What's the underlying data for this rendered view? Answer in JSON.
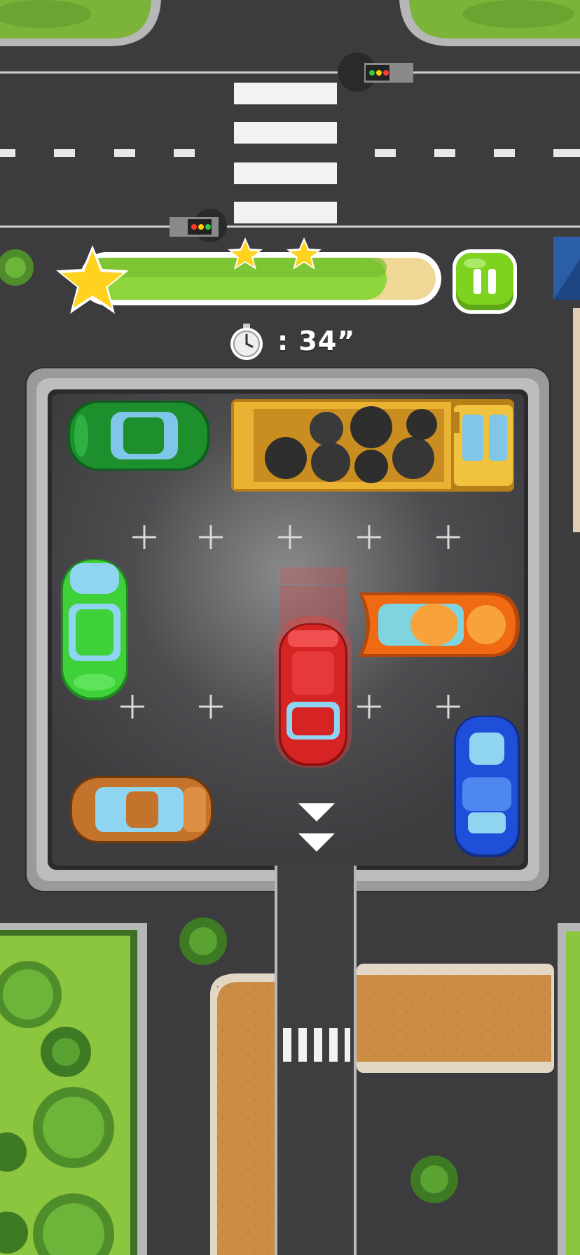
{
  "game": {
    "progress": {
      "fill_fraction": 0.86,
      "stars_earned": 3
    },
    "timer": {
      "label": ": 34”",
      "seconds": 34
    },
    "buttons": {
      "pause": "pause"
    },
    "exit_direction": "down",
    "vehicles": [
      {
        "name": "green-car",
        "color": "#1e8f2d",
        "orientation": "horizontal"
      },
      {
        "name": "dump-truck",
        "color": "#e9b233",
        "orientation": "horizontal",
        "cargo": "coal"
      },
      {
        "name": "lime-car",
        "color": "#3fd13a",
        "orientation": "vertical"
      },
      {
        "name": "red-player-car",
        "color": "#d62424",
        "orientation": "vertical",
        "selected": true
      },
      {
        "name": "orange-car",
        "color": "#f06a12",
        "orientation": "horizontal"
      },
      {
        "name": "blue-car",
        "color": "#1f4fd8",
        "orientation": "vertical"
      },
      {
        "name": "brown-car",
        "color": "#c4732c",
        "orientation": "horizontal"
      }
    ],
    "colors": {
      "road": "#3c3c3f",
      "lot": "#4b4b4e",
      "grass": "#8cc63f",
      "progress_fill": "#8fd63c",
      "progress_track": "#efd796",
      "pause_button": "#7ed321",
      "star": "#ffd21f"
    }
  }
}
